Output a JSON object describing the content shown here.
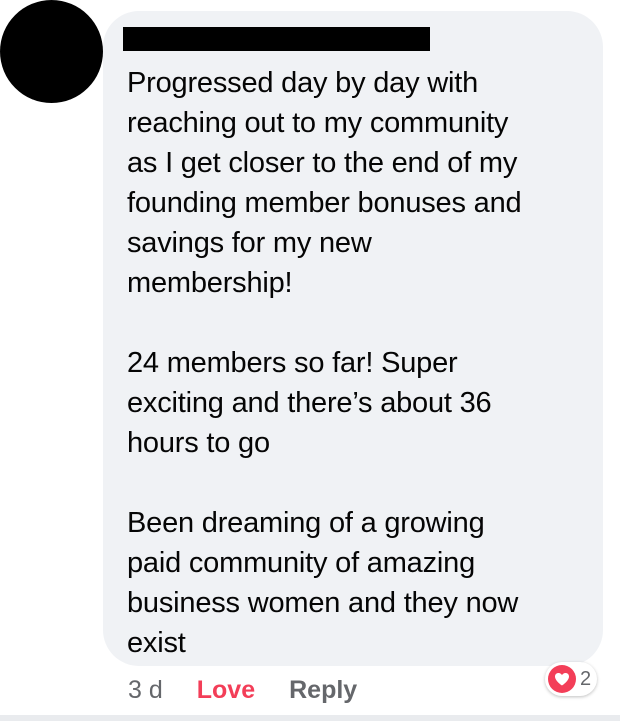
{
  "comment": {
    "author_name": "",
    "paragraphs": [
      "Progressed day by day with\nreaching out to my community\nas I get closer to the end of my\nfounding member bonuses and\nsavings for my new\nmembership!",
      "24 members so far! Super\nexciting and there’s about 36\nhours to go",
      "Been dreaming of a growing\npaid community of amazing\nbusiness women and they now\nexist"
    ]
  },
  "actions": {
    "timestamp": "3 d",
    "reaction_label": "Love",
    "reply_label": "Reply"
  },
  "reactions": {
    "icon": "heart-icon",
    "count": "2",
    "color": "#f33e58"
  },
  "colors": {
    "bubble_background": "#f0f2f5",
    "text": "#050505",
    "secondary_text": "#65676b",
    "love_accent": "#f33e58"
  }
}
